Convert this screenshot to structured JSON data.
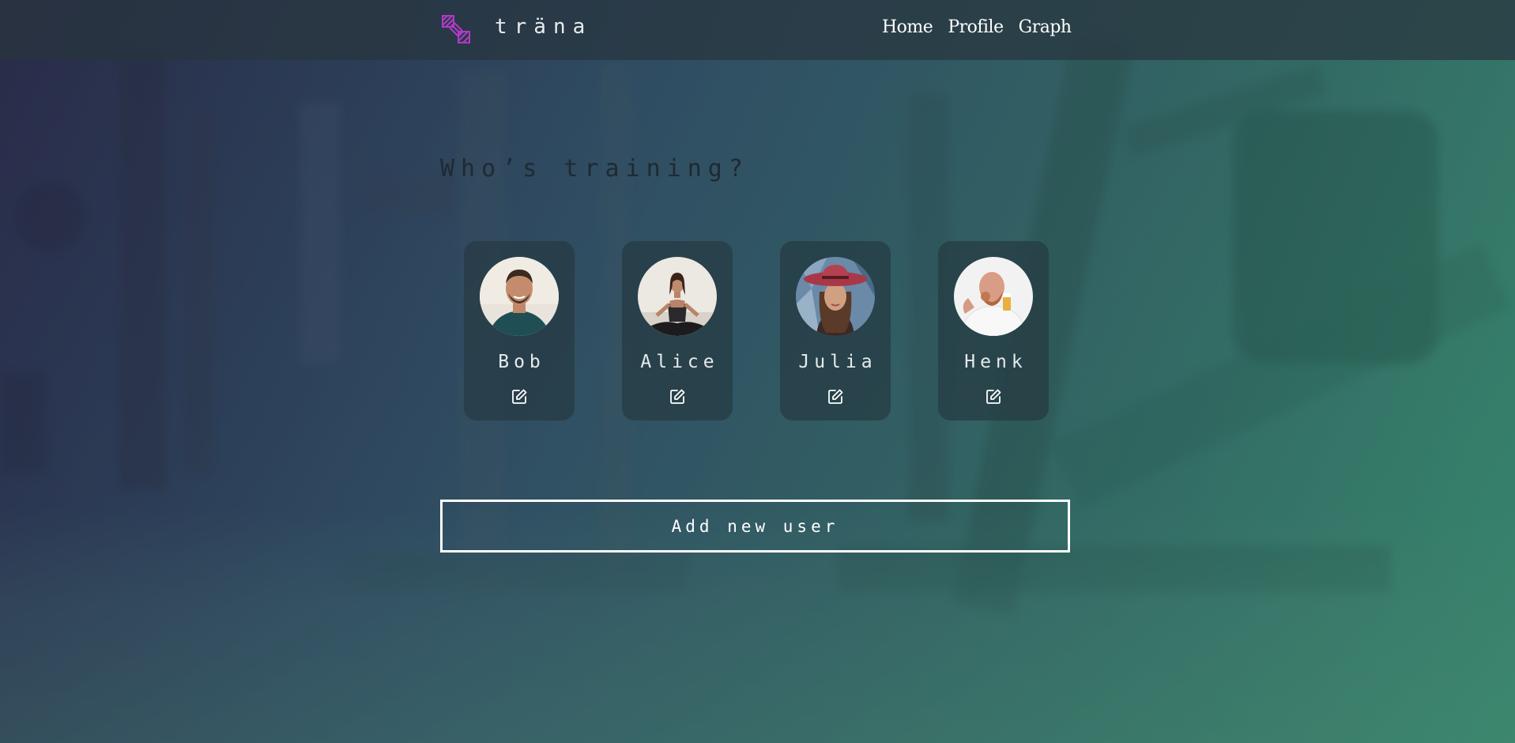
{
  "navbar": {
    "brand": "träna",
    "links": [
      {
        "label": "Home"
      },
      {
        "label": "Profile"
      },
      {
        "label": "Graph"
      }
    ]
  },
  "main": {
    "heading": "Who’s training?",
    "users": [
      {
        "name": "Bob",
        "avatar": "photo-man-smiling-teal-shirt"
      },
      {
        "name": "Alice",
        "avatar": "photo-woman-yoga-pose"
      },
      {
        "name": "Julia",
        "avatar": "photo-woman-red-hat"
      },
      {
        "name": "Henk",
        "avatar": "photo-bald-man-eating"
      }
    ],
    "add_user_label": "Add new user"
  },
  "colors": {
    "logo_accent": "#b03ac8",
    "text_light": "#ffffff",
    "heading_dark": "#1e2a33",
    "card_bg": "#263a42"
  }
}
